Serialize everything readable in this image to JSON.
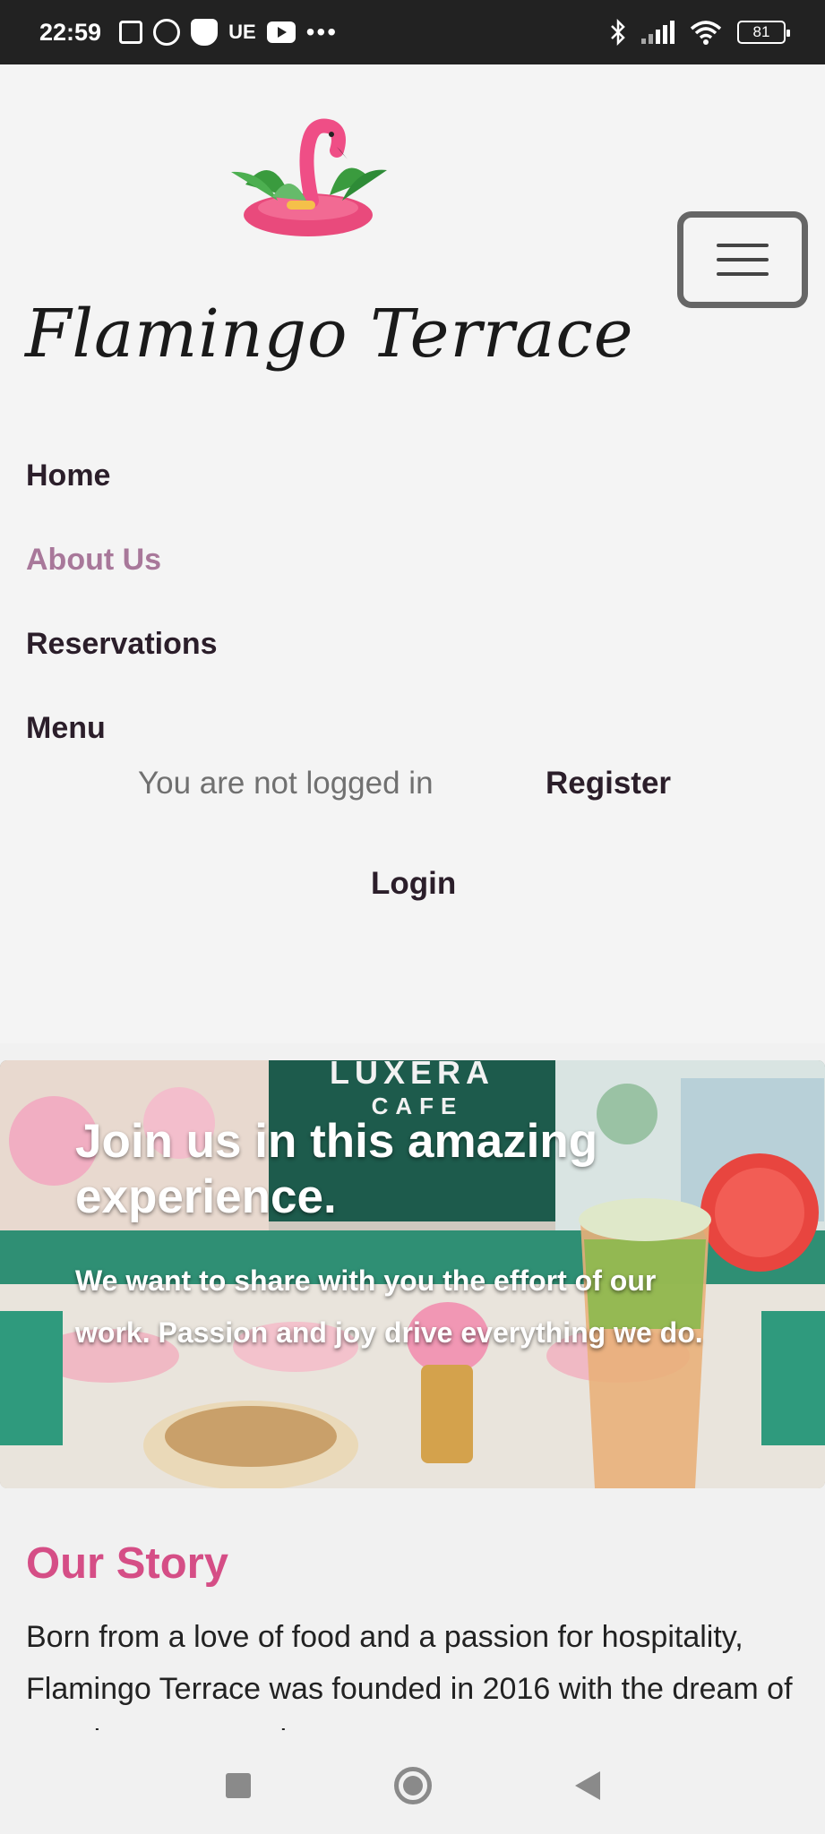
{
  "status_bar": {
    "time": "22:59",
    "carrier_label": "UE",
    "more": "•••",
    "battery": "81"
  },
  "header": {
    "brand": "Flamingo Terrace",
    "nav": [
      {
        "label": "Home",
        "active": false
      },
      {
        "label": "About Us",
        "active": true
      },
      {
        "label": "Reservations",
        "active": false
      },
      {
        "label": "Menu",
        "active": false
      }
    ],
    "login_status": "You are not logged in",
    "register_label": "Register",
    "login_label": "Login"
  },
  "hero": {
    "title": "Join us in this amazing experience.",
    "subtitle": "We want to share with you the effort of our work. Passion and joy drive everything we do.",
    "sign_line1": "LUXERA",
    "sign_line2": "CAFE"
  },
  "story": {
    "title": "Our Story",
    "text": "Born from a love of food and a passion for hospitality, Flamingo Terrace was founded in 2016 with the dream of creating a space where guests"
  },
  "colors": {
    "accent_pink": "#d54e86",
    "active_nav": "#a8789a",
    "text_dark": "#2b1e2a"
  }
}
